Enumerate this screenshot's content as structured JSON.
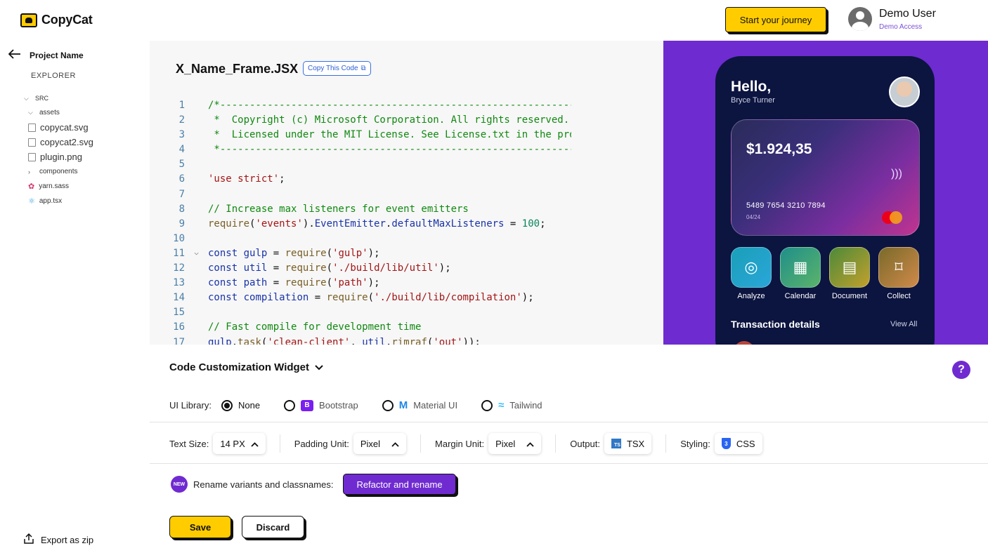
{
  "app": {
    "name": "CopyCat"
  },
  "header": {
    "cta_label": "Start your journey",
    "user_name": "Demo User",
    "user_sub": "Demo Access"
  },
  "sidebar": {
    "project_name": "Project Name",
    "explorer_label": "EXPLORER",
    "tree": {
      "src": "SRC",
      "assets": "assets",
      "files": [
        "copycat.svg",
        "copycat2.svg",
        "plugin.png"
      ],
      "components": "components",
      "yarn": "yarn.sass",
      "app": "app.tsx"
    },
    "export_label": "Export as zip"
  },
  "editor": {
    "file_name": "X_Name_Frame.JSX",
    "copy_label": "Copy This Code",
    "line_numbers": [
      "1",
      "2",
      "3",
      "4",
      "5",
      "6",
      "7",
      "8",
      "9",
      "10",
      "11",
      "12",
      "13",
      "14",
      "15",
      "16",
      "17"
    ]
  },
  "preview": {
    "greeting": "Hello,",
    "user": "Bryce Turner",
    "balance": "$1.924,35",
    "card_number": "5489 7654 3210 7894",
    "card_expiry": "04/24",
    "actions": [
      "Analyze",
      "Calendar",
      "Document",
      "Collect"
    ],
    "tx_title": "Transaction details",
    "tx_view_all": "View All"
  },
  "widget": {
    "title": "Code Customization Widget",
    "ui_library_label": "UI Library:",
    "ui_options": [
      "None",
      "Bootstrap",
      "Material UI",
      "Tailwind"
    ],
    "ui_selected": "None",
    "text_size_label": "Text Size:",
    "text_size_value": "14 PX",
    "padding_label": "Padding Unit:",
    "padding_value": "Pixel",
    "margin_label": "Margin Unit:",
    "margin_value": "Pixel",
    "output_label": "Output:",
    "output_value": "TSX",
    "styling_label": "Styling:",
    "styling_value": "CSS",
    "new_badge": "NEW",
    "rename_label": "Rename variants and classnames:",
    "refactor_label": "Refactor and rename",
    "save_label": "Save",
    "discard_label": "Discard"
  },
  "colors": {
    "accent_yellow": "#ffcc00",
    "accent_purple": "#6f2bd0",
    "preview_bg": "#6e2bd0"
  }
}
